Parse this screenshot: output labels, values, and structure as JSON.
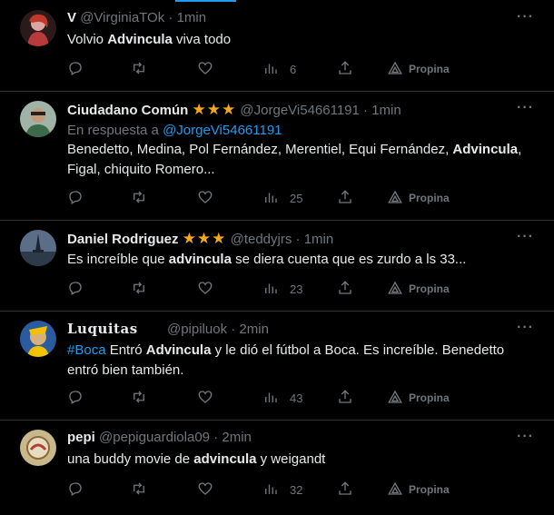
{
  "tweets": [
    {
      "name": "V",
      "handle": "@VirginiaTOk",
      "sep": "·",
      "time": "1min",
      "text": [
        "Volvio ",
        "Advincula",
        " viva todo"
      ],
      "views": "6",
      "promote": "Propina"
    },
    {
      "name": "Ciudadano Común",
      "stars": "★★★",
      "handle": "@JorgeVi54661191",
      "sep": "·",
      "time": "1min",
      "reply_prefix": "En respuesta a",
      "reply_to": "@JorgeVi54661191",
      "text": [
        "Benedetto, Medina, Pol Fernández, Merentiel, Equi Fernández, ",
        "Advincula",
        ",",
        "Figal, chiquito Romero..."
      ],
      "views": "25",
      "promote": "Propina"
    },
    {
      "name": "Daniel Rodriguez",
      "stars": "★★★",
      "handle": "@teddyjrs",
      "sep": "·",
      "time": "1min",
      "text": [
        "Es increíble que ",
        "advincula",
        " se diera cuenta que es zurdo a ls 33..."
      ],
      "views": "23",
      "promote": "Propina"
    },
    {
      "name": "Luquitas",
      "handle": "@pipiluok",
      "sep": "·",
      "time": "2min",
      "text": [
        "#Boca",
        " Entró ",
        "Advincula",
        " y le dió el fútbol a Boca. Es increíble. Benedetto",
        "entró bien también."
      ],
      "views": "43",
      "promote": "Propina"
    },
    {
      "name": "pepi",
      "handle": "@pepiguardiola09",
      "sep": "·",
      "time": "2min",
      "text": [
        "una buddy movie de ",
        "advincula",
        " y weigandt"
      ],
      "views": "32",
      "promote": "Propina"
    }
  ],
  "more_label": "···",
  "colors": {
    "accent": "#1d9bf0",
    "star": "#f4a81d",
    "muted": "#71767b",
    "background": "#000000"
  }
}
